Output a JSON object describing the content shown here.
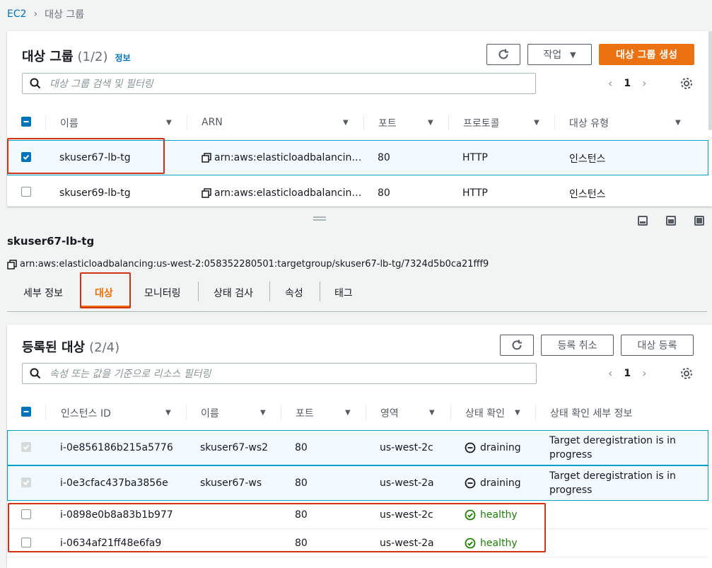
{
  "breadcrumb": {
    "root": "EC2",
    "current": "대상 그룹"
  },
  "tg_panel": {
    "title": "대상 그룹",
    "count": "(1/2)",
    "info": "정보",
    "actions_label": "작업",
    "create_label": "대상 그룹 생성",
    "search_placeholder": "대상 그룹 검색 및 필터링",
    "page": "1",
    "columns": [
      "이름",
      "ARN",
      "포트",
      "프로토콜",
      "대상 유형"
    ],
    "rows": [
      {
        "name": "skuser67-lb-tg",
        "arn": "arn:aws:elasticloadbalancin…",
        "port": "80",
        "protocol": "HTTP",
        "type": "인스턴스",
        "checked": true
      },
      {
        "name": "skuser69-lb-tg",
        "arn": "arn:aws:elasticloadbalancin…",
        "port": "80",
        "protocol": "HTTP",
        "type": "인스턴스",
        "checked": false
      }
    ]
  },
  "detail": {
    "name": "skuser67-lb-tg",
    "arn": "arn:aws:elasticloadbalancing:us-west-2:058352280501:targetgroup/skuser67-lb-tg/7324d5b0ca21fff9",
    "tabs": [
      "세부 정보",
      "대상",
      "모니터링",
      "상태 검사",
      "속성",
      "태그"
    ],
    "active_tab": "대상"
  },
  "targets_panel": {
    "title": "등록된 대상",
    "count": "(2/4)",
    "deregister_label": "등록 취소",
    "register_label": "대상 등록",
    "search_placeholder": "속성 또는 값을 기준으로 리소스 필터링",
    "page": "1",
    "columns": [
      "인스턴스 ID",
      "이름",
      "포트",
      "영역",
      "상태 확인",
      "상태 확인 세부 정보"
    ],
    "rows": [
      {
        "id": "i-0e856186b215a5776",
        "name": "skuser67-ws2",
        "port": "80",
        "zone": "us-west-2c",
        "health": "draining",
        "details_1": "Target deregistration is in",
        "details_2": "progress"
      },
      {
        "id": "i-0e3cfac437ba3856e",
        "name": "skuser67-ws",
        "port": "80",
        "zone": "us-west-2a",
        "health": "draining",
        "details_1": "Target deregistration is in",
        "details_2": "progress"
      },
      {
        "id": "i-0898e0b8a83b1b977",
        "name": "",
        "port": "80",
        "zone": "us-west-2c",
        "health": "healthy",
        "details_1": "",
        "details_2": ""
      },
      {
        "id": "i-0634af21ff48e6fa9",
        "name": "",
        "port": "80",
        "zone": "us-west-2a",
        "health": "healthy",
        "details_1": "",
        "details_2": ""
      }
    ]
  },
  "colors": {
    "accent": "#0073bb",
    "primary": "#ec7211",
    "healthy": "#1d8102",
    "highlight": "#d13212"
  }
}
